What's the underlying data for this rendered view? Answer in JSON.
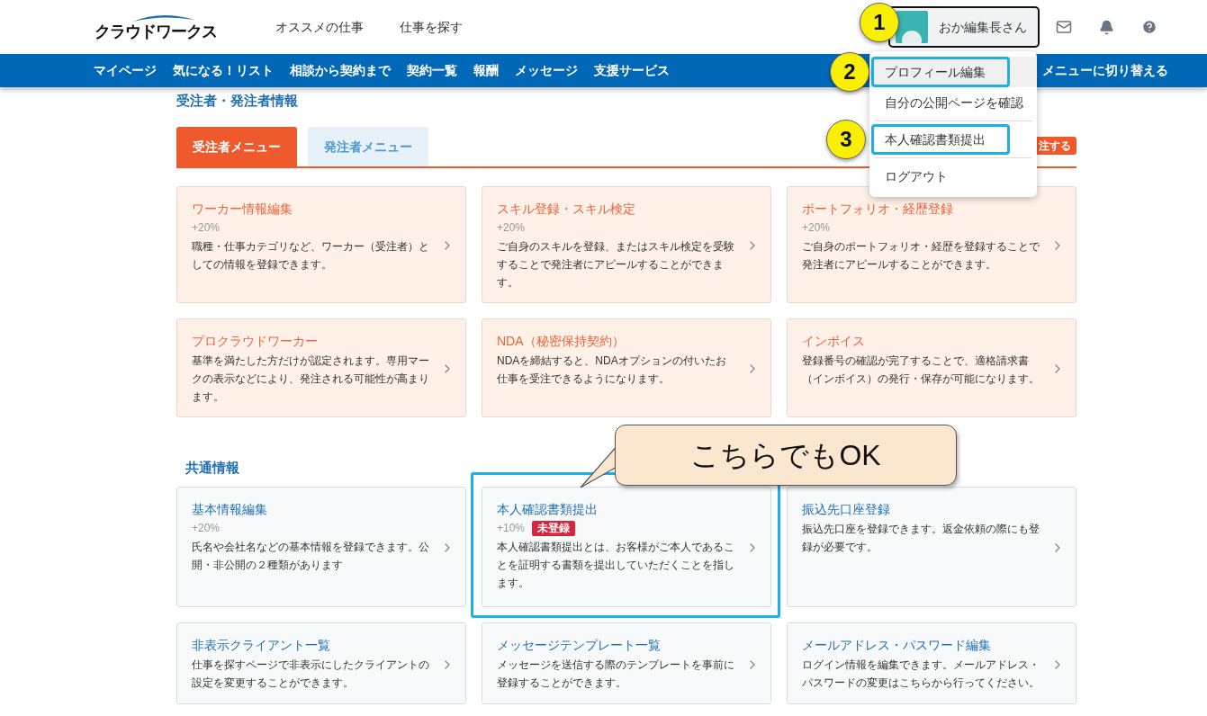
{
  "header": {
    "logo": "クラウドワークス",
    "nav": [
      "オススメの仕事",
      "仕事を探す"
    ],
    "user_name": "おか編集長さん"
  },
  "subnav": {
    "items": [
      "マイページ",
      "気になる！リスト",
      "相談から契約まで",
      "契約一覧",
      "報酬",
      "メッセージ",
      "支援サービス"
    ],
    "switch_text": "メニューに切り替える"
  },
  "page_title": "受注者・発注者情報",
  "tabs": [
    {
      "label": "受注者メニュー",
      "selected": true
    },
    {
      "label": "発注者メニュー",
      "selected": false
    }
  ],
  "order_button": "注する",
  "sections": [
    {
      "kind": "worker",
      "cards": [
        {
          "title": "ワーカー情報編集",
          "bonus": "+20%",
          "description": "職種・仕事カテゴリなど、ワーカー（受注者）としての情報を登録できます。"
        },
        {
          "title": "スキル登録・スキル検定",
          "bonus": "+20%",
          "description": "ご自身のスキルを登録、またはスキル検定を受験することで発注者にアピールすることができます。"
        },
        {
          "title": "ポートフォリオ・経歴登録",
          "bonus": "+20%",
          "description": "ご自身のポートフォリオ・経歴を登録することで発注者にアピールすることができます。"
        },
        {
          "title": "プロクラウドワーカー",
          "description": "基準を満たした方だけが認定されます。専用マークの表示などにより、発注される可能性が高まります。"
        },
        {
          "title": "NDA（秘密保持契約）",
          "description": "NDAを締結すると、NDAオプションの付いたお仕事を受注できるようになります。"
        },
        {
          "title": "インボイス",
          "description": "登録番号の確認が完了することで、適格請求書（インボイス）の発行・保存が可能になります。"
        }
      ]
    },
    {
      "kind": "common",
      "title": "共通情報",
      "cards": [
        {
          "title": "基本情報編集",
          "bonus": "+20%",
          "description": "氏名や会社名などの基本情報を登録できます。公開・非公開の２種類があります"
        },
        {
          "title": "本人確認書類提出",
          "bonus": "+10%",
          "badge": "未登録",
          "highlighted": true,
          "description": "本人確認書類提出とは、お客様がご本人であることを証明する書類を提出していただくことを指します。"
        },
        {
          "title": "振込先口座登録",
          "description": "振込先口座を登録できます。返金依頼の際にも登録が必要です。"
        },
        {
          "title": "非表示クライアント一覧",
          "description": "仕事を探すページで非表示にしたクライアントの設定を変更することができます。"
        },
        {
          "title": "メッセージテンプレート一覧",
          "description": "メッセージを送信する際のテンプレートを事前に登録することができます。"
        },
        {
          "title": "メールアドレス・パスワード編集",
          "description": "ログイン情報を編集できます。メールアドレス・パスワードの変更はこちらから行ってください。"
        }
      ]
    }
  ],
  "dropdown": [
    {
      "label": "プロフィール編集",
      "hovered": true,
      "divider_before": false,
      "highlighted": true
    },
    {
      "label": "自分の公開ページを確認",
      "hovered": false,
      "divider_before": false,
      "highlighted": false
    },
    {
      "label": "本人確認書類提出",
      "hovered": false,
      "divider_before": true,
      "highlighted": true
    },
    {
      "label": "ログアウト",
      "hovered": false,
      "divider_before": true,
      "highlighted": false
    }
  ],
  "step_markers": [
    "1",
    "2",
    "3"
  ],
  "callout": "こちらでもOK"
}
